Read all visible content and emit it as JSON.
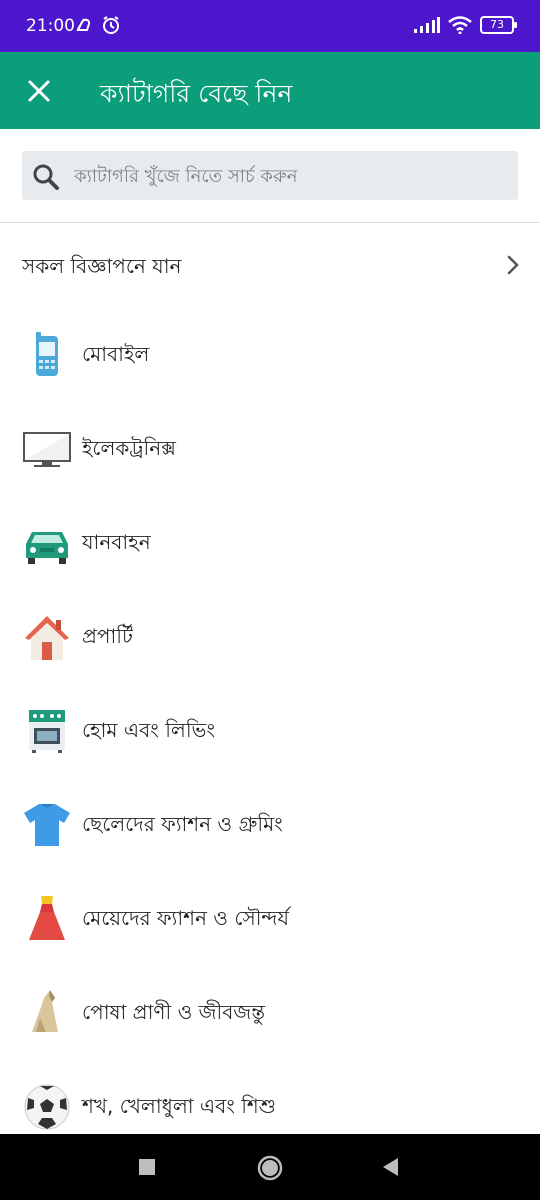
{
  "status_bar": {
    "time": "21:00",
    "battery": "73"
  },
  "app_bar": {
    "title": "ক্যাটাগরি বেছে নিন"
  },
  "search": {
    "placeholder": "ক্যাটাগরি খুঁজে নিতে সার্চ করুন"
  },
  "all_ads": {
    "label": "সকল বিজ্ঞাপনে যান"
  },
  "categories": [
    {
      "label": "মোবাইল",
      "icon": "mobile-phone-icon"
    },
    {
      "label": "ইলেকট্রনিক্স",
      "icon": "tv-monitor-icon"
    },
    {
      "label": "যানবাহন",
      "icon": "car-icon"
    },
    {
      "label": "প্রপার্টি",
      "icon": "house-icon"
    },
    {
      "label": "হোম এবং লিভিং",
      "icon": "stove-icon"
    },
    {
      "label": "ছেলেদের ফ্যাশন ও গ্রুমিং",
      "icon": "tshirt-icon"
    },
    {
      "label": "মেয়েদের ফ্যাশন ও সৌন্দর্য",
      "icon": "dress-icon"
    },
    {
      "label": "পোষা প্রাণী ও জীবজন্তু",
      "icon": "dog-icon"
    },
    {
      "label": "শখ, খেলাধুলা এবং শিশু",
      "icon": "football-icon"
    }
  ],
  "colors": {
    "status_bar": "#4c17cc",
    "app_bar": "#0c9d7a",
    "search_bg": "#e7ebee"
  }
}
